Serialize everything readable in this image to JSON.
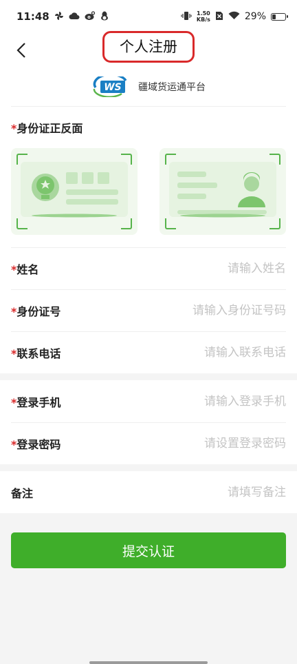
{
  "status_bar": {
    "time": "11:48",
    "net_speed_value": "1.50",
    "net_speed_unit": "KB/s",
    "battery_text": "29%",
    "battery_level": 0.29
  },
  "header": {
    "title": "个人注册"
  },
  "brand": {
    "logo_letters": "WS",
    "name": "疆域货运通平台"
  },
  "id_section": {
    "required_mark": "*",
    "label": "身份证正反面"
  },
  "fields": {
    "name": {
      "required_mark": "*",
      "label": "姓名",
      "placeholder": "请输入姓名",
      "value": ""
    },
    "id_number": {
      "required_mark": "*",
      "label": "身份证号",
      "placeholder": "请输入身份证号码",
      "value": ""
    },
    "phone": {
      "required_mark": "*",
      "label": "联系电话",
      "placeholder": "请输入联系电话",
      "value": ""
    },
    "login_phone": {
      "required_mark": "*",
      "label": "登录手机",
      "placeholder": "请输入登录手机",
      "value": ""
    },
    "password": {
      "required_mark": "*",
      "label": "登录密码",
      "placeholder": "请设置登录密码",
      "value": ""
    },
    "remark": {
      "label": "备注",
      "placeholder": "请填写备注",
      "value": ""
    }
  },
  "submit": {
    "label": "提交认证"
  },
  "colors": {
    "accent": "#3fae2a",
    "required": "#d9292a",
    "annotation": "#d9292a",
    "placeholder": "#c4c4c4"
  }
}
